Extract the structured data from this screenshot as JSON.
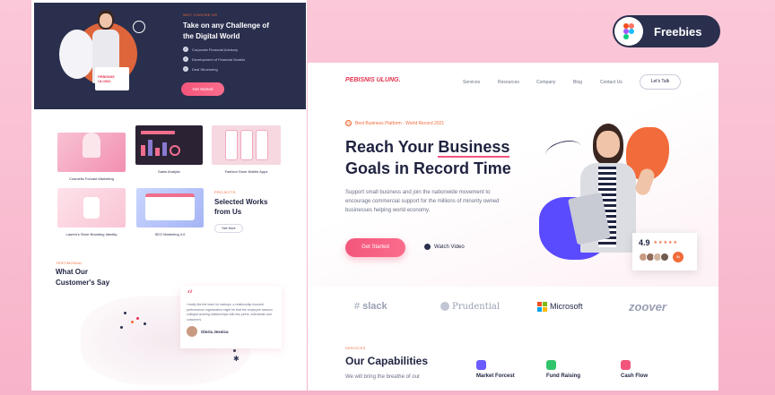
{
  "badge": {
    "label": "Freebies",
    "icon": "figma-logo"
  },
  "left_page": {
    "hero": {
      "eyebrow": "WHY CHOOSE US",
      "title_line1": "Take on any Challenge of",
      "title_line2": "the Digital World",
      "checks": [
        "Corporate Financial Advisory",
        "Development of Financial Models",
        "Deal Structuring"
      ],
      "cta": "Get Started",
      "box_label": "PEBISNIS ULUNG."
    },
    "portfolio": [
      {
        "label": "Cosmetic Forcast Marketing"
      },
      {
        "label": "Sales Analytic"
      },
      {
        "label": "Fashion Store Mobile Apps"
      },
      {
        "label": "Lauren's Store Branding Identity"
      },
      {
        "label": "SEO Marketing 4.0"
      }
    ],
    "projects": {
      "eyebrow": "PROJECTS",
      "title_line1": "Selected Works",
      "title_line2": "from Us",
      "button": "See More"
    },
    "testimonial": {
      "eyebrow": "TESTIMONIAL",
      "title_line1": "What Our",
      "title_line2": "Customer's Say",
      "quote_mark": "“",
      "quote": "I really like the team for startups, a relationship-focused performance organization might be that the employee session collegial working relationships with two peers, individuals and customers.",
      "author": "Gloria Jessica"
    }
  },
  "right_page": {
    "logo": "PEBISNIS ULUNG.",
    "nav": [
      "Services",
      "Resources",
      "Company",
      "Blog",
      "Contact Us"
    ],
    "nav_cta": "Let's Talk",
    "tagline": "Best Business Platform - World Record 2021",
    "headline_line1_pre": "Reach Your ",
    "headline_line1_hl": "Business",
    "headline_line2": "Goals in Record Time",
    "body": "Support small business and join the nationwide movement to encourage commercial support for the millions of minority owned businesses helping world economy.",
    "cta": "Get Started",
    "watch": "Watch Video",
    "rating": {
      "score": "4.9",
      "stars": "★★★★★",
      "stars_value": 5,
      "more": "5k"
    },
    "brands": [
      "slack",
      "Prudential",
      "Microsoft",
      "zoover"
    ],
    "capabilities": {
      "eyebrow": "SERVICES",
      "title": "Our Capabilities",
      "body": "We will bring the breathe of our",
      "items": [
        {
          "label": "Market Forcest",
          "color": "#6a5cff"
        },
        {
          "label": "Fund Raising",
          "color": "#32c46b"
        },
        {
          "label": "Cash Flow",
          "color": "#f2557b"
        }
      ]
    }
  },
  "colors": {
    "accent": "#f2557b",
    "navy": "#2a2f4e",
    "orange": "#f26b3a",
    "purple": "#5a4bff"
  }
}
